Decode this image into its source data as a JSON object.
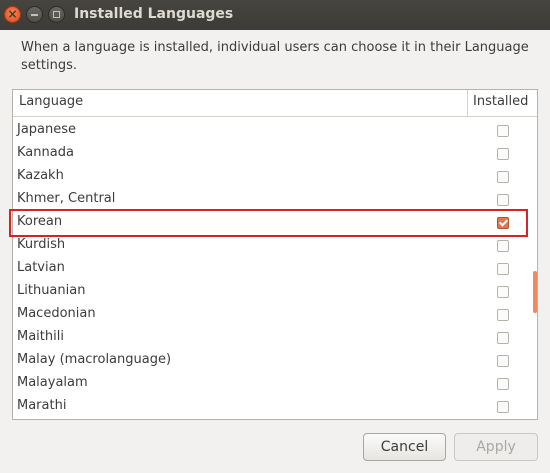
{
  "window": {
    "title": "Installed Languages",
    "close_glyph": "×"
  },
  "description": "When a language is installed, individual users can choose it in their Language settings.",
  "table": {
    "columns": [
      "Language",
      "Installed"
    ],
    "rows": [
      {
        "label": "Japanese",
        "installed": false
      },
      {
        "label": "Kannada",
        "installed": false
      },
      {
        "label": "Kazakh",
        "installed": false
      },
      {
        "label": "Khmer, Central",
        "installed": false
      },
      {
        "label": "Korean",
        "installed": true
      },
      {
        "label": "Kurdish",
        "installed": false
      },
      {
        "label": "Latvian",
        "installed": false
      },
      {
        "label": "Lithuanian",
        "installed": false
      },
      {
        "label": "Macedonian",
        "installed": false
      },
      {
        "label": "Maithili",
        "installed": false
      },
      {
        "label": "Malay (macrolanguage)",
        "installed": false
      },
      {
        "label": "Malayalam",
        "installed": false
      },
      {
        "label": "Marathi",
        "installed": false
      }
    ]
  },
  "buttons": {
    "cancel": "Cancel",
    "apply": "Apply"
  },
  "colors": {
    "accent": "#e1784d",
    "highlight": "#d8222a",
    "scroll_thumb": "#f08962"
  }
}
